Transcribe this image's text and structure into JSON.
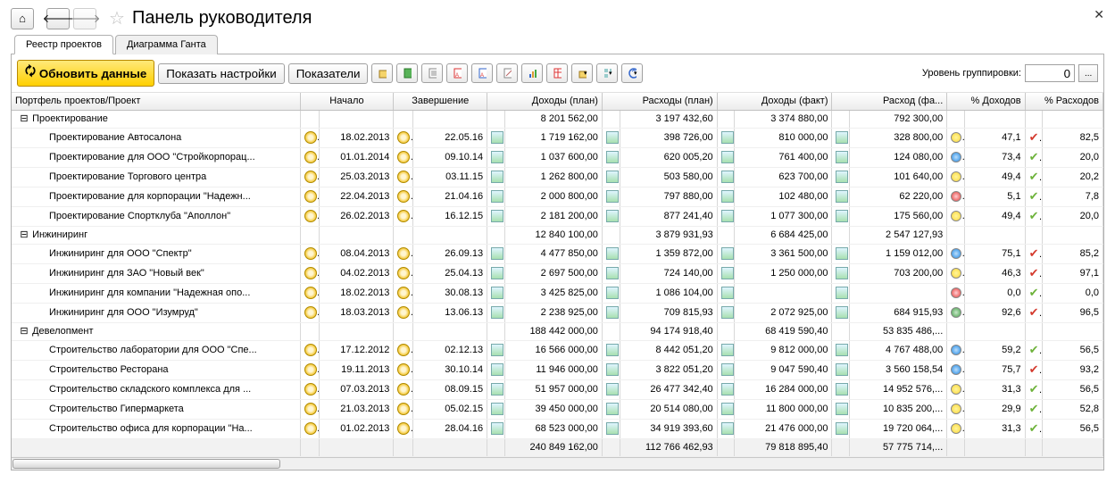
{
  "title": "Панель руководителя",
  "tabs": [
    "Реестр проектов",
    "Диаграмма Ганта"
  ],
  "toolbar": {
    "refresh": "Обновить данные",
    "show_settings": "Показать настройки",
    "indicators": "Показатели",
    "group_label": "Уровень группировки:",
    "group_value": "0"
  },
  "toolbar_icons": [
    "folder-icon",
    "book-icon",
    "list-icon",
    "table-red-icon",
    "table-blue-icon",
    "edit-icon",
    "chart-icon",
    "grid-red-icon",
    "folder-open-icon",
    "tree-icon",
    "refresh-small-icon"
  ],
  "columns": [
    "Портфель проектов/Проект",
    "Начало",
    "Завершение",
    "Доходы (план)",
    "Расходы (план)",
    "Доходы (факт)",
    "Расход (фа...",
    "% Доходов",
    "% Расходов"
  ],
  "rows": [
    {
      "type": "group",
      "name": "Проектирование",
      "inc_p": "8 201 562,00",
      "exp_p": "3 197 432,60",
      "inc_f": "3 374 880,00",
      "exp_f": "792 300,00"
    },
    {
      "type": "child",
      "name": "Проектирование Автосалона",
      "start": "18.02.2013",
      "end": "22.05.16",
      "inc_p": "1 719 162,00",
      "exp_p": "398 726,00",
      "inc_f": "810 000,00",
      "exp_f": "328 800,00",
      "led": "y",
      "pi": "47,1",
      "chk": "r",
      "pe": "82,5"
    },
    {
      "type": "child",
      "name": "Проектирование для ООО \"Стройкорпорац...",
      "start": "01.01.2014",
      "end": "09.10.14",
      "inc_p": "1 037 600,00",
      "exp_p": "620 005,20",
      "inc_f": "761 400,00",
      "exp_f": "124 080,00",
      "led": "b",
      "pi": "73,4",
      "chk": "g",
      "pe": "20,0"
    },
    {
      "type": "child",
      "name": "Проектирование Торгового центра",
      "start": "25.03.2013",
      "end": "03.11.15",
      "inc_p": "1 262 800,00",
      "exp_p": "503 580,00",
      "inc_f": "623 700,00",
      "exp_f": "101 640,00",
      "led": "y",
      "pi": "49,4",
      "chk": "g",
      "pe": "20,2"
    },
    {
      "type": "child",
      "name": "Проектирование для корпорации \"Надежн...",
      "start": "22.04.2013",
      "end": "21.04.16",
      "inc_p": "2 000 800,00",
      "exp_p": "797 880,00",
      "inc_f": "102 480,00",
      "exp_f": "62 220,00",
      "led": "r",
      "pi": "5,1",
      "chk": "g",
      "pe": "7,8"
    },
    {
      "type": "child",
      "name": "Проектирование Спортклуба \"Аполлон\"",
      "start": "26.02.2013",
      "end": "16.12.15",
      "inc_p": "2 181 200,00",
      "exp_p": "877 241,40",
      "inc_f": "1 077 300,00",
      "exp_f": "175 560,00",
      "led": "y",
      "pi": "49,4",
      "chk": "g",
      "pe": "20,0"
    },
    {
      "type": "group",
      "name": "Инжиниринг",
      "inc_p": "12 840 100,00",
      "exp_p": "3 879 931,93",
      "inc_f": "6 684 425,00",
      "exp_f": "2 547 127,93"
    },
    {
      "type": "child",
      "name": "Инжиниринг для ООО \"Спектр\"",
      "start": "08.04.2013",
      "end": "26.09.13",
      "inc_p": "4 477 850,00",
      "exp_p": "1 359 872,00",
      "inc_f": "3 361 500,00",
      "exp_f": "1 159 012,00",
      "led": "b",
      "pi": "75,1",
      "chk": "r",
      "pe": "85,2"
    },
    {
      "type": "child",
      "name": "Инжиниринг для ЗАО \"Новый век\"",
      "start": "04.02.2013",
      "end": "25.04.13",
      "inc_p": "2 697 500,00",
      "exp_p": "724 140,00",
      "inc_f": "1 250 000,00",
      "exp_f": "703 200,00",
      "led": "y",
      "pi": "46,3",
      "chk": "r",
      "pe": "97,1"
    },
    {
      "type": "child",
      "name": "Инжиниринг для компании \"Надежная опо...",
      "start": "18.02.2013",
      "end": "30.08.13",
      "inc_p": "3 425 825,00",
      "exp_p": "1 086 104,00",
      "inc_f": "",
      "exp_f": "",
      "led": "r",
      "pi": "0,0",
      "chk": "g",
      "pe": "0,0"
    },
    {
      "type": "child",
      "name": "Инжиниринг для ООО \"Изумруд\"",
      "start": "18.03.2013",
      "end": "13.06.13",
      "inc_p": "2 238 925,00",
      "exp_p": "709 815,93",
      "inc_f": "2 072 925,00",
      "exp_f": "684 915,93",
      "led": "g",
      "pi": "92,6",
      "chk": "r",
      "pe": "96,5"
    },
    {
      "type": "group",
      "name": "Девелопмент",
      "inc_p": "188 442 000,00",
      "exp_p": "94 174 918,40",
      "inc_f": "68 419 590,40",
      "exp_f": "53 835 486,..."
    },
    {
      "type": "child",
      "name": "Строительство лаборатории для ООО \"Спе...",
      "start": "17.12.2012",
      "end": "02.12.13",
      "inc_p": "16 566 000,00",
      "exp_p": "8 442 051,20",
      "inc_f": "9 812 000,00",
      "exp_f": "4 767 488,00",
      "led": "b",
      "pi": "59,2",
      "chk": "g",
      "pe": "56,5"
    },
    {
      "type": "child",
      "name": "Строительство Ресторана",
      "start": "19.11.2013",
      "end": "30.10.14",
      "inc_p": "11 946 000,00",
      "exp_p": "3 822 051,20",
      "inc_f": "9 047 590,40",
      "exp_f": "3 560 158,54",
      "led": "b",
      "pi": "75,7",
      "chk": "r",
      "pe": "93,2"
    },
    {
      "type": "child",
      "name": "Строительство складского комплекса для ...",
      "start": "07.03.2013",
      "end": "08.09.15",
      "inc_p": "51 957 000,00",
      "exp_p": "26 477 342,40",
      "inc_f": "16 284 000,00",
      "exp_f": "14 952 576,...",
      "led": "y",
      "pi": "31,3",
      "chk": "g",
      "pe": "56,5"
    },
    {
      "type": "child",
      "name": "Строительство Гипермаркета",
      "start": "21.03.2013",
      "end": "05.02.15",
      "inc_p": "39 450 000,00",
      "exp_p": "20 514 080,00",
      "inc_f": "11 800 000,00",
      "exp_f": "10 835 200,...",
      "led": "y",
      "pi": "29,9",
      "chk": "g",
      "pe": "52,8"
    },
    {
      "type": "child",
      "name": "Строительство офиса для корпорации \"На...",
      "start": "01.02.2013",
      "end": "28.04.16",
      "inc_p": "68 523 000,00",
      "exp_p": "34 919 393,60",
      "inc_f": "21 476 000,00",
      "exp_f": "19 720 064,...",
      "led": "y",
      "pi": "31,3",
      "chk": "g",
      "pe": "56,5"
    }
  ],
  "totals": {
    "inc_p": "240 849 162,00",
    "exp_p": "112 766 462,93",
    "inc_f": "79 818 895,40",
    "exp_f": "57 775 714,..."
  }
}
